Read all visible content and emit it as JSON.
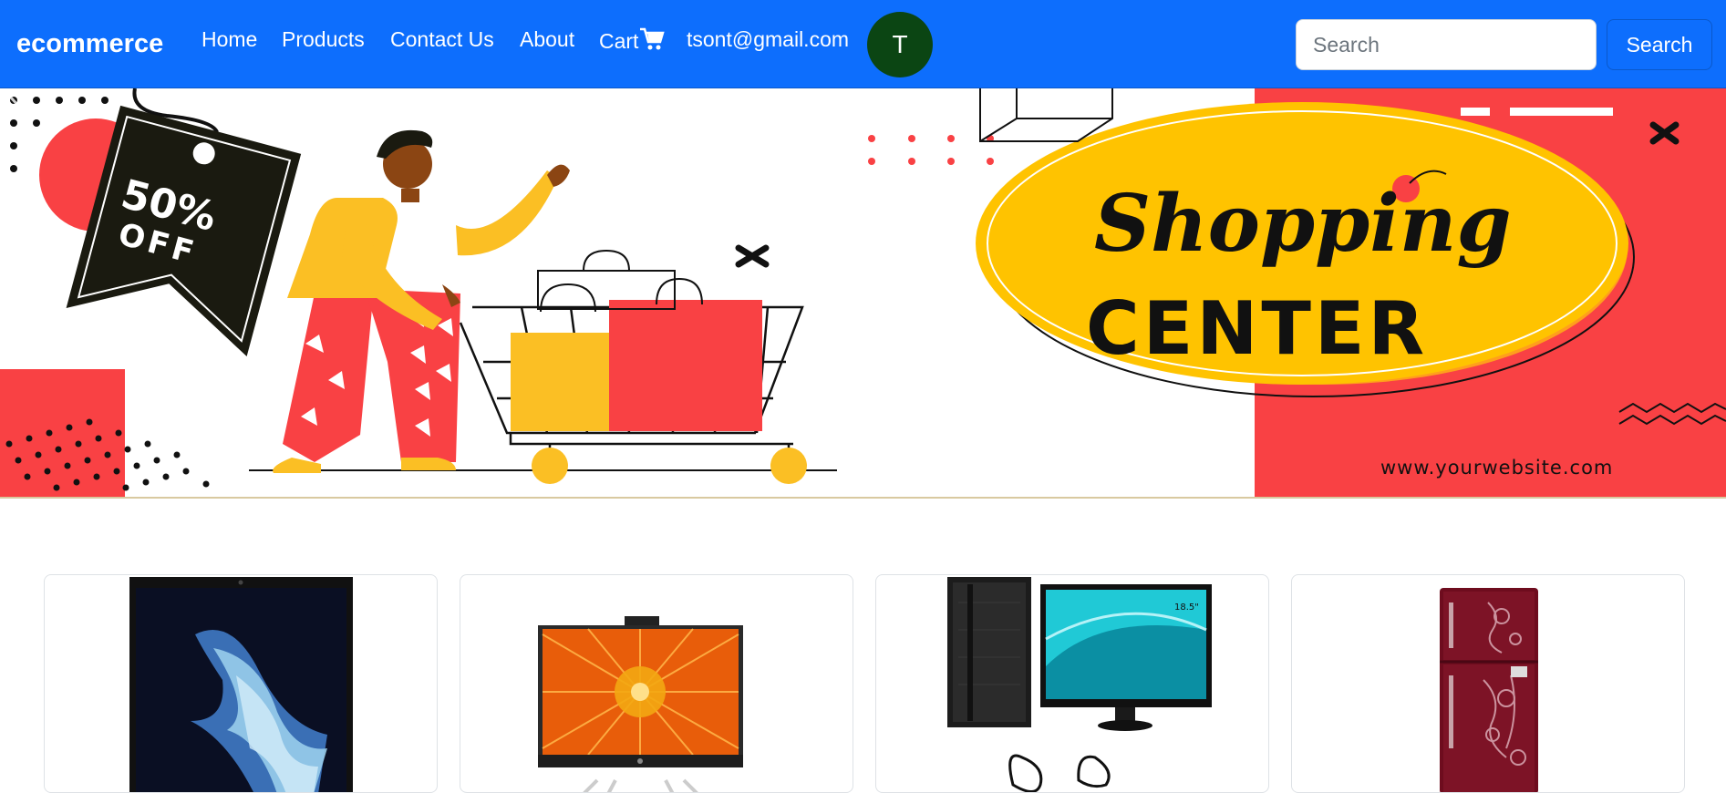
{
  "navbar": {
    "brand": "ecommerce",
    "links": {
      "home": "Home",
      "products": "Products",
      "contact": "Contact Us",
      "about": "About",
      "cart": "Cart"
    },
    "user_email": "tsont@gmail.com",
    "avatar_initial": "T",
    "search_placeholder": "Search",
    "search_button": "Search"
  },
  "banner": {
    "discount_top": "50%",
    "discount_bottom": "OFF",
    "headline_script": "Shopping",
    "headline_bold": "CENTER",
    "website": "www.yourwebsite.com"
  },
  "products": [
    {
      "image": "laptop"
    },
    {
      "image": "all-in-one-desktop"
    },
    {
      "image": "desktop-pc-with-monitor"
    },
    {
      "image": "refrigerator"
    }
  ],
  "colors": {
    "navbar": "#0d6efd",
    "avatar": "#0b4513",
    "banner_red": "#f94144",
    "banner_yellow": "#ffc300"
  }
}
